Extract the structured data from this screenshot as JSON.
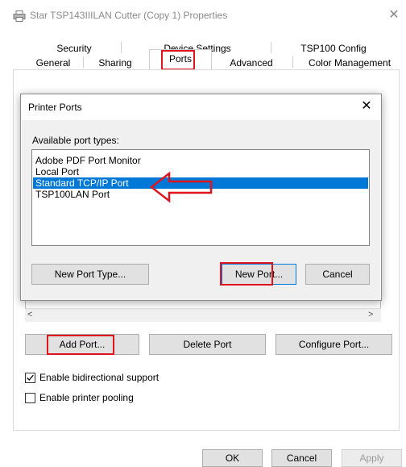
{
  "window": {
    "title": "Star TSP143IIILAN Cutter (Copy 1) Properties",
    "close_glyph": "✕"
  },
  "tabs": {
    "row1": [
      "Security",
      "Device Settings",
      "TSP100 Config"
    ],
    "row2": [
      "General",
      "Sharing",
      "Ports",
      "Advanced",
      "Color Management"
    ],
    "active": "Ports"
  },
  "ports_page": {
    "add_port": "Add Port...",
    "delete_port": "Delete Port",
    "configure_port": "Configure Port...",
    "bidirectional_label": "Enable bidirectional support",
    "bidirectional_checked": true,
    "pooling_label": "Enable printer pooling",
    "pooling_checked": false
  },
  "footer": {
    "ok": "OK",
    "cancel": "Cancel",
    "apply": "Apply"
  },
  "dialog": {
    "title": "Printer Ports",
    "close_glyph": "✕",
    "available_label": "Available port types:",
    "port_types": [
      "Adobe PDF Port Monitor",
      "Local Port",
      "Standard TCP/IP Port",
      "TSP100LAN Port"
    ],
    "selected_index": 2,
    "new_port_type": "New Port Type...",
    "new_port": "New Port...",
    "cancel": "Cancel"
  },
  "colors": {
    "highlight_box": "#e0141e",
    "selection": "#0078d7"
  },
  "icons": {
    "title": "printer-icon",
    "pointer": "red-outline-arrow-icon"
  }
}
